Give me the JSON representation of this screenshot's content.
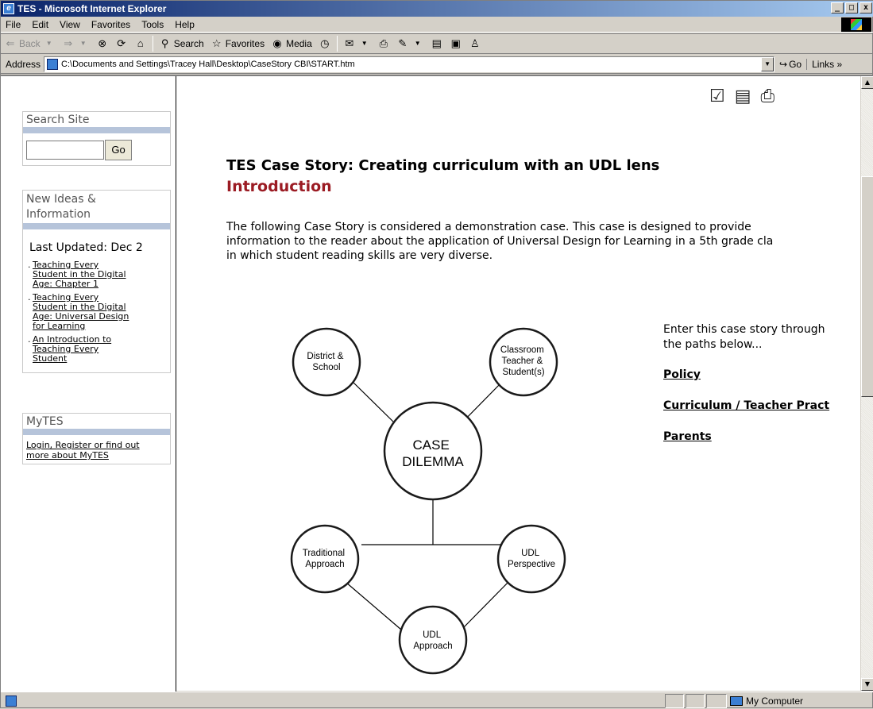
{
  "window": {
    "title": "TES - Microsoft Internet Explorer",
    "controls": [
      "_",
      "□",
      "x"
    ]
  },
  "menu": [
    "File",
    "Edit",
    "View",
    "Favorites",
    "Tools",
    "Help"
  ],
  "toolbar": {
    "back": "Back",
    "search": "Search",
    "favorites": "Favorites",
    "media": "Media"
  },
  "address": {
    "label": "Address",
    "url": "C:\\Documents and Settings\\Tracey Hall\\Desktop\\CaseStory CBI\\START.htm",
    "go": "Go",
    "links": "Links »"
  },
  "sidebar": {
    "search": {
      "title": "Search Site",
      "button": "Go"
    },
    "ideas": {
      "title_line1": "New Ideas &",
      "title_line2": "Information",
      "last_updated": "Last Updated: Dec 2",
      "links": [
        {
          "lines": [
            "Teaching Every",
            "Student in the Digital",
            "Age: Chapter 1"
          ]
        },
        {
          "lines": [
            "Teaching Every",
            "Student in the Digital",
            "Age: Universal Design",
            "for Learning"
          ]
        },
        {
          "lines": [
            "An Introduction to",
            "Teaching Every",
            "Student"
          ]
        }
      ]
    },
    "mytes": {
      "title": "MyTES",
      "link_line1": "Login, Register or find out",
      "link_line2": "more about MyTES"
    }
  },
  "main": {
    "title": "TES Case Story: Creating curriculum with an UDL lens",
    "subtitle": "Introduction",
    "intro_lines": [
      "The following Case Story is considered a demonstration case. This case is designed to provide",
      "information to the reader about the application of Universal Design for Learning in a 5th grade cla",
      "in which student reading skills are very diverse."
    ],
    "diagram": {
      "center": [
        "CASE",
        "DILEMMA"
      ],
      "nodes": {
        "district": [
          "District &",
          "School"
        ],
        "classroom": [
          "Classroom",
          "Teacher &",
          "Student(s)"
        ],
        "traditional": [
          "Traditional",
          "Approach"
        ],
        "udl_perspective": [
          "UDL",
          "Perspective"
        ],
        "udl_approach": [
          "UDL",
          "Approach"
        ]
      }
    },
    "enter_line1": "Enter this case story through",
    "enter_line2": "the paths below...",
    "paths": [
      "Policy",
      "Curriculum / Teacher Pract",
      "Parents"
    ]
  },
  "status": {
    "zone": "My Computer"
  }
}
